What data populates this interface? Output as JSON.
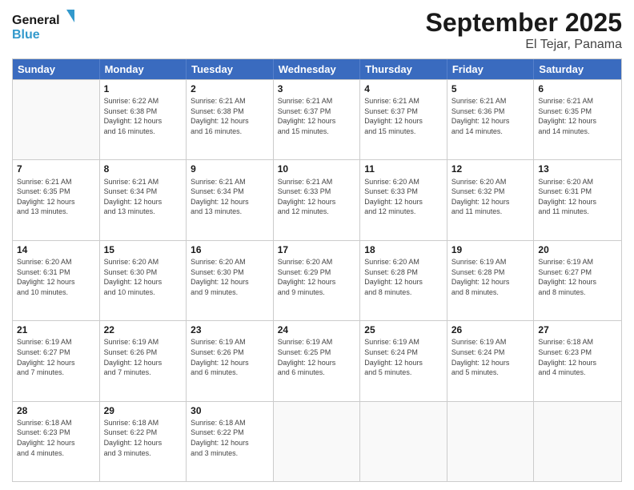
{
  "header": {
    "logo_line1": "General",
    "logo_line2": "Blue",
    "title": "September 2025",
    "subtitle": "El Tejar, Panama"
  },
  "weekdays": [
    "Sunday",
    "Monday",
    "Tuesday",
    "Wednesday",
    "Thursday",
    "Friday",
    "Saturday"
  ],
  "rows": [
    [
      {
        "day": "",
        "info": ""
      },
      {
        "day": "1",
        "info": "Sunrise: 6:22 AM\nSunset: 6:38 PM\nDaylight: 12 hours\nand 16 minutes."
      },
      {
        "day": "2",
        "info": "Sunrise: 6:21 AM\nSunset: 6:38 PM\nDaylight: 12 hours\nand 16 minutes."
      },
      {
        "day": "3",
        "info": "Sunrise: 6:21 AM\nSunset: 6:37 PM\nDaylight: 12 hours\nand 15 minutes."
      },
      {
        "day": "4",
        "info": "Sunrise: 6:21 AM\nSunset: 6:37 PM\nDaylight: 12 hours\nand 15 minutes."
      },
      {
        "day": "5",
        "info": "Sunrise: 6:21 AM\nSunset: 6:36 PM\nDaylight: 12 hours\nand 14 minutes."
      },
      {
        "day": "6",
        "info": "Sunrise: 6:21 AM\nSunset: 6:35 PM\nDaylight: 12 hours\nand 14 minutes."
      }
    ],
    [
      {
        "day": "7",
        "info": "Sunrise: 6:21 AM\nSunset: 6:35 PM\nDaylight: 12 hours\nand 13 minutes."
      },
      {
        "day": "8",
        "info": "Sunrise: 6:21 AM\nSunset: 6:34 PM\nDaylight: 12 hours\nand 13 minutes."
      },
      {
        "day": "9",
        "info": "Sunrise: 6:21 AM\nSunset: 6:34 PM\nDaylight: 12 hours\nand 13 minutes."
      },
      {
        "day": "10",
        "info": "Sunrise: 6:21 AM\nSunset: 6:33 PM\nDaylight: 12 hours\nand 12 minutes."
      },
      {
        "day": "11",
        "info": "Sunrise: 6:20 AM\nSunset: 6:33 PM\nDaylight: 12 hours\nand 12 minutes."
      },
      {
        "day": "12",
        "info": "Sunrise: 6:20 AM\nSunset: 6:32 PM\nDaylight: 12 hours\nand 11 minutes."
      },
      {
        "day": "13",
        "info": "Sunrise: 6:20 AM\nSunset: 6:31 PM\nDaylight: 12 hours\nand 11 minutes."
      }
    ],
    [
      {
        "day": "14",
        "info": "Sunrise: 6:20 AM\nSunset: 6:31 PM\nDaylight: 12 hours\nand 10 minutes."
      },
      {
        "day": "15",
        "info": "Sunrise: 6:20 AM\nSunset: 6:30 PM\nDaylight: 12 hours\nand 10 minutes."
      },
      {
        "day": "16",
        "info": "Sunrise: 6:20 AM\nSunset: 6:30 PM\nDaylight: 12 hours\nand 9 minutes."
      },
      {
        "day": "17",
        "info": "Sunrise: 6:20 AM\nSunset: 6:29 PM\nDaylight: 12 hours\nand 9 minutes."
      },
      {
        "day": "18",
        "info": "Sunrise: 6:20 AM\nSunset: 6:28 PM\nDaylight: 12 hours\nand 8 minutes."
      },
      {
        "day": "19",
        "info": "Sunrise: 6:19 AM\nSunset: 6:28 PM\nDaylight: 12 hours\nand 8 minutes."
      },
      {
        "day": "20",
        "info": "Sunrise: 6:19 AM\nSunset: 6:27 PM\nDaylight: 12 hours\nand 8 minutes."
      }
    ],
    [
      {
        "day": "21",
        "info": "Sunrise: 6:19 AM\nSunset: 6:27 PM\nDaylight: 12 hours\nand 7 minutes."
      },
      {
        "day": "22",
        "info": "Sunrise: 6:19 AM\nSunset: 6:26 PM\nDaylight: 12 hours\nand 7 minutes."
      },
      {
        "day": "23",
        "info": "Sunrise: 6:19 AM\nSunset: 6:26 PM\nDaylight: 12 hours\nand 6 minutes."
      },
      {
        "day": "24",
        "info": "Sunrise: 6:19 AM\nSunset: 6:25 PM\nDaylight: 12 hours\nand 6 minutes."
      },
      {
        "day": "25",
        "info": "Sunrise: 6:19 AM\nSunset: 6:24 PM\nDaylight: 12 hours\nand 5 minutes."
      },
      {
        "day": "26",
        "info": "Sunrise: 6:19 AM\nSunset: 6:24 PM\nDaylight: 12 hours\nand 5 minutes."
      },
      {
        "day": "27",
        "info": "Sunrise: 6:18 AM\nSunset: 6:23 PM\nDaylight: 12 hours\nand 4 minutes."
      }
    ],
    [
      {
        "day": "28",
        "info": "Sunrise: 6:18 AM\nSunset: 6:23 PM\nDaylight: 12 hours\nand 4 minutes."
      },
      {
        "day": "29",
        "info": "Sunrise: 6:18 AM\nSunset: 6:22 PM\nDaylight: 12 hours\nand 3 minutes."
      },
      {
        "day": "30",
        "info": "Sunrise: 6:18 AM\nSunset: 6:22 PM\nDaylight: 12 hours\nand 3 minutes."
      },
      {
        "day": "",
        "info": ""
      },
      {
        "day": "",
        "info": ""
      },
      {
        "day": "",
        "info": ""
      },
      {
        "day": "",
        "info": ""
      }
    ]
  ]
}
